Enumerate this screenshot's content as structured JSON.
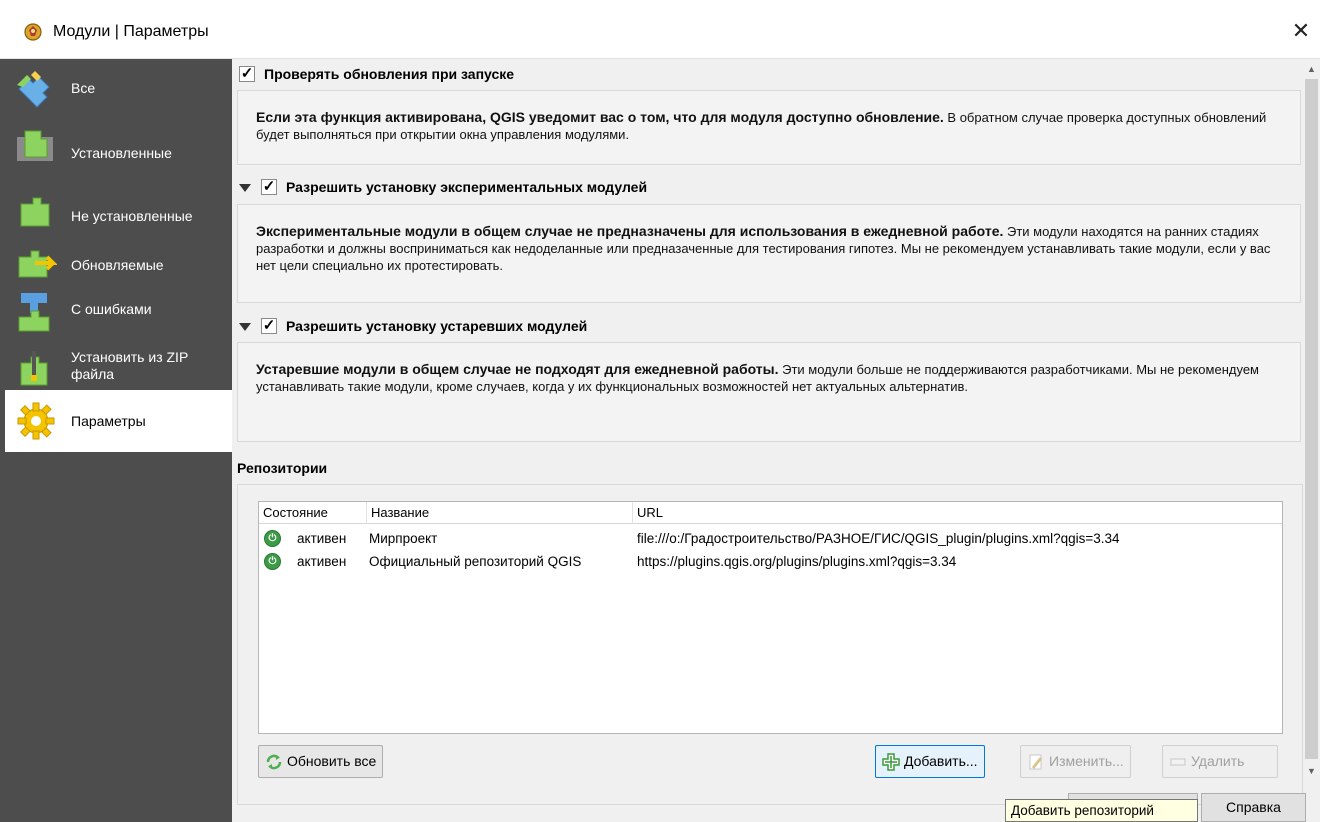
{
  "window": {
    "title": "Модули | Параметры",
    "close_label": "✕"
  },
  "sidebar": {
    "items": [
      {
        "label": "Все",
        "icon": "puzzle-all-icon"
      },
      {
        "label": "Установленные",
        "icon": "puzzle-installed-icon"
      },
      {
        "label": "Не установленные",
        "icon": "puzzle-not-installed-icon"
      },
      {
        "label": "Обновляемые",
        "icon": "puzzle-upgradeable-icon"
      },
      {
        "label": "C ошибками",
        "icon": "puzzle-broken-icon"
      },
      {
        "label": "Установить из ZIP файла",
        "icon": "zip-install-icon"
      },
      {
        "label": "Параметры",
        "icon": "settings-gear-icon",
        "active": true
      }
    ]
  },
  "settings": {
    "check_updates": {
      "checked": true,
      "label": "Проверять обновления при запуске",
      "desc_bold": "Если эта функция активирована, QGIS уведомит вас о том, что для модуля доступно обновление.",
      "desc_rest": " В обратном случае проверка доступных обновлений будет выполняться при открытии окна управления модулями."
    },
    "experimental": {
      "checked": true,
      "label": "Разрешить установку экспериментальных модулей",
      "desc_bold": "Экспериментальные модули в общем случае не предназначены для использования в ежедневной работе.",
      "desc_rest": " Эти модули находятся на ранних стадиях разработки и должны восприниматься как недоделанные или предназаченные для тестирования гипотез. Мы не рекомендуем устанавливать такие модули, если у вас нет цели специально их протестировать."
    },
    "deprecated": {
      "checked": true,
      "label": "Разрешить установку устаревших модулей",
      "desc_bold": "Устаревшие модули в общем случае не подходят для ежедневной работы.",
      "desc_rest": " Эти модули больше не поддерживаются разработчиками. Мы не рекомендуем устанавливать такие модули, кроме случаев, когда у их функциональных возможностей нет актуальных альтернатив."
    }
  },
  "repositories": {
    "section_label": "Репозитории",
    "columns": [
      "Состояние",
      "Название",
      "URL"
    ],
    "rows": [
      {
        "status": "активен",
        "name": "Мирпроект",
        "url": "file:///o:/Градостроительство/РАЗНОЕ/ГИС/QGIS_plugin/plugins.xml?qgis=3.34"
      },
      {
        "status": "активен",
        "name": "Официальный репозиторий QGIS",
        "url": "https://plugins.qgis.org/plugins/plugins.xml?qgis=3.34"
      }
    ],
    "buttons": {
      "reload": "Обновить все",
      "add": "Добавить...",
      "edit": "Изменить...",
      "delete": "Удалить"
    }
  },
  "footer": {
    "help": "Справка",
    "tooltip": "Добавить репозиторий"
  },
  "colors": {
    "sidebar_bg": "#4d4d4d",
    "status_active": "#3d9b47"
  }
}
